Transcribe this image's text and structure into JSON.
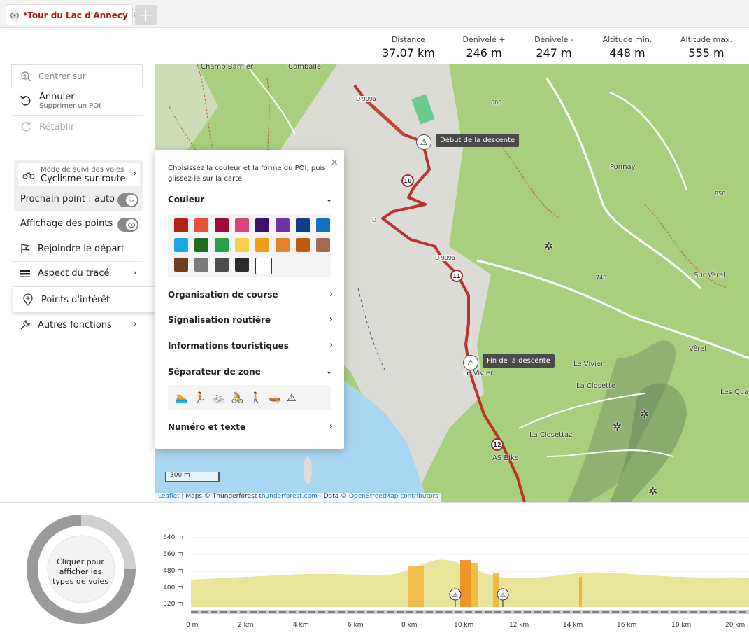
{
  "tab": {
    "title": "*Tour du Lac d'Annecy",
    "close": "×",
    "add": "+"
  },
  "stats": [
    {
      "label": "Distance",
      "value": "37.07 km"
    },
    {
      "label": "Dénivelé +",
      "value": "246 m"
    },
    {
      "label": "Dénivelé -",
      "value": "247 m"
    },
    {
      "label": "Altitude min.",
      "value": "448 m"
    },
    {
      "label": "Altitude max.",
      "value": "555 m"
    }
  ],
  "sidebar": {
    "center_placeholder": "Centrer sur",
    "undo": {
      "label": "Annuler",
      "sub": "Supprimer un POI"
    },
    "redo": "Rétablir",
    "mode": {
      "small": "Mode de suivi des voies",
      "big": "Cyclisme sur route"
    },
    "next_point": "Prochain point : auto",
    "points_display": "Affichage des points",
    "join_start": "Rejoindre le départ",
    "track_style": "Aspect du tracé",
    "poi": "Points d'intérêt",
    "other": "Autres fonctions"
  },
  "map": {
    "labels": [
      "Champ Barnier",
      "Comballe",
      "Ponnay",
      "Sur Vêrel",
      "Vêrel",
      "Le Vivier",
      "La Closette",
      "Les Quar",
      "La Closettaz",
      "AS Bike",
      "Le Vivier",
      "D 909a",
      "D 909a",
      "D",
      "600",
      "850",
      "740"
    ],
    "tooltips": {
      "start": "Début de la descente",
      "end": "Fin de la descente"
    },
    "km_markers": [
      "10",
      "11",
      "12"
    ],
    "scale": "300 m",
    "attribution": {
      "leaflet": "Leaflet",
      "mid": " | Maps © Thunderforest ",
      "tf": "thunderforest.com",
      "data": " - Data © ",
      "osm": "OpenStreetMap contributors"
    }
  },
  "poi_panel": {
    "intro": "Choisissez la couleur et la forme du POI, puis glissez-le sur la carte",
    "close": "×",
    "sections": {
      "color": "Couleur",
      "race": "Organisation de course",
      "road": "Signalisation routière",
      "tourism": "Informations touristiques",
      "zone": "Séparateur de zone",
      "number": "Numéro et texte"
    },
    "colors": [
      "#b5221a",
      "#e5533c",
      "#9b0f3c",
      "#d9437e",
      "#3d1269",
      "#7033a3",
      "#0d3f8a",
      "#1472c3",
      "#1ba7e8",
      "#1e6e1e",
      "#27a04a",
      "#f8cf4a",
      "#f29b16",
      "#e7822a",
      "#c25a0d",
      "#a06d50",
      "#6e3e1c",
      "#7b7b7b",
      "#4d4d4d",
      "#2b2b2b",
      "#ffffff"
    ],
    "zone_icons": [
      "swim-icon",
      "run-icon",
      "bike-icon",
      "cycle-icon",
      "walk-icon",
      "kayak-icon",
      "warning-icon"
    ]
  },
  "elevation": {
    "donut_text": "Cliquer pour afficher les types de voies",
    "y_ticks": [
      "640 m",
      "560 m",
      "480 m",
      "400 m",
      "320 m"
    ],
    "x_ticks": [
      "0 m",
      "2 km",
      "4 km",
      "6 km",
      "8 km",
      "10 km",
      "12 km",
      "14 km",
      "16 km",
      "18 km",
      "20 km"
    ]
  },
  "colors": {
    "accent": "#b01818",
    "route": "#b8201c"
  }
}
